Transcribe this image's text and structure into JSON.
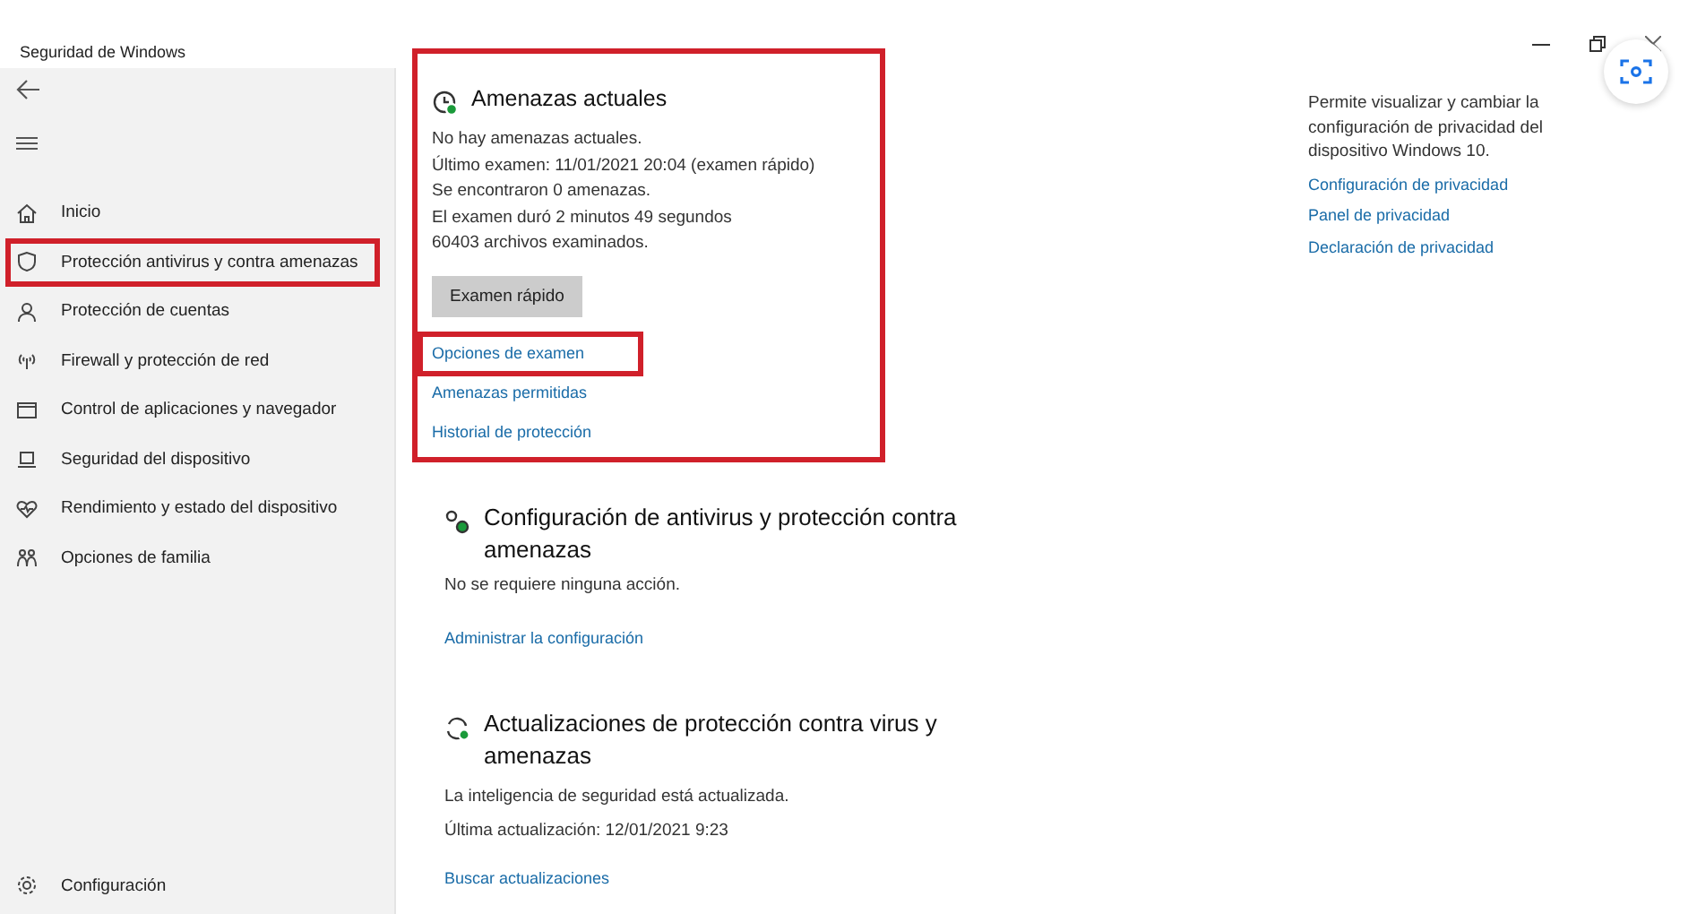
{
  "window": {
    "title": "Seguridad de Windows"
  },
  "sidebar": {
    "items": [
      {
        "label": "Inicio",
        "highlighted": false
      },
      {
        "label": "Protección antivirus y contra amenazas",
        "highlighted": true
      },
      {
        "label": "Protección de cuentas",
        "highlighted": false
      },
      {
        "label": "Firewall y protección de red",
        "highlighted": false
      },
      {
        "label": "Control de aplicaciones y navegador",
        "highlighted": false
      },
      {
        "label": "Seguridad del dispositivo",
        "highlighted": false
      },
      {
        "label": "Rendimiento y estado del dispositivo",
        "highlighted": false
      },
      {
        "label": "Opciones de familia",
        "highlighted": false
      }
    ],
    "footer": {
      "label": "Configuración"
    }
  },
  "sections": [
    {
      "title": "Amenazas actuales",
      "highlighted": true,
      "lines": [
        "No hay amenazas actuales.",
        "Último examen: 11/01/2021 20:04 (examen rápido)",
        "Se encontraron 0 amenazas.",
        "El examen duró 2 minutos 49 segundos",
        "60403 archivos examinados."
      ],
      "button": "Examen rápido",
      "links": [
        {
          "label": "Opciones de examen",
          "highlighted": true
        },
        {
          "label": "Amenazas permitidas",
          "highlighted": false
        },
        {
          "label": "Historial de protección",
          "highlighted": false
        }
      ]
    },
    {
      "title": "Configuración de antivirus y protección contra amenazas",
      "highlighted": false,
      "lines": [
        "No se requiere ninguna acción."
      ],
      "links": [
        {
          "label": "Administrar la configuración",
          "highlighted": false
        }
      ]
    },
    {
      "title": "Actualizaciones de protección contra virus y amenazas",
      "highlighted": false,
      "lines": [
        "La inteligencia de seguridad está actualizada.",
        "Última actualización: 12/01/2021 9:23"
      ],
      "links": [
        {
          "label": "Buscar actualizaciones",
          "highlighted": false
        }
      ]
    }
  ],
  "privacy": {
    "description": "Permite visualizar y cambiar la configuración de privacidad del dispositivo Windows 10.",
    "links": [
      "Configuración de privacidad",
      "Panel de privacidad",
      "Declaración de privacidad"
    ]
  }
}
